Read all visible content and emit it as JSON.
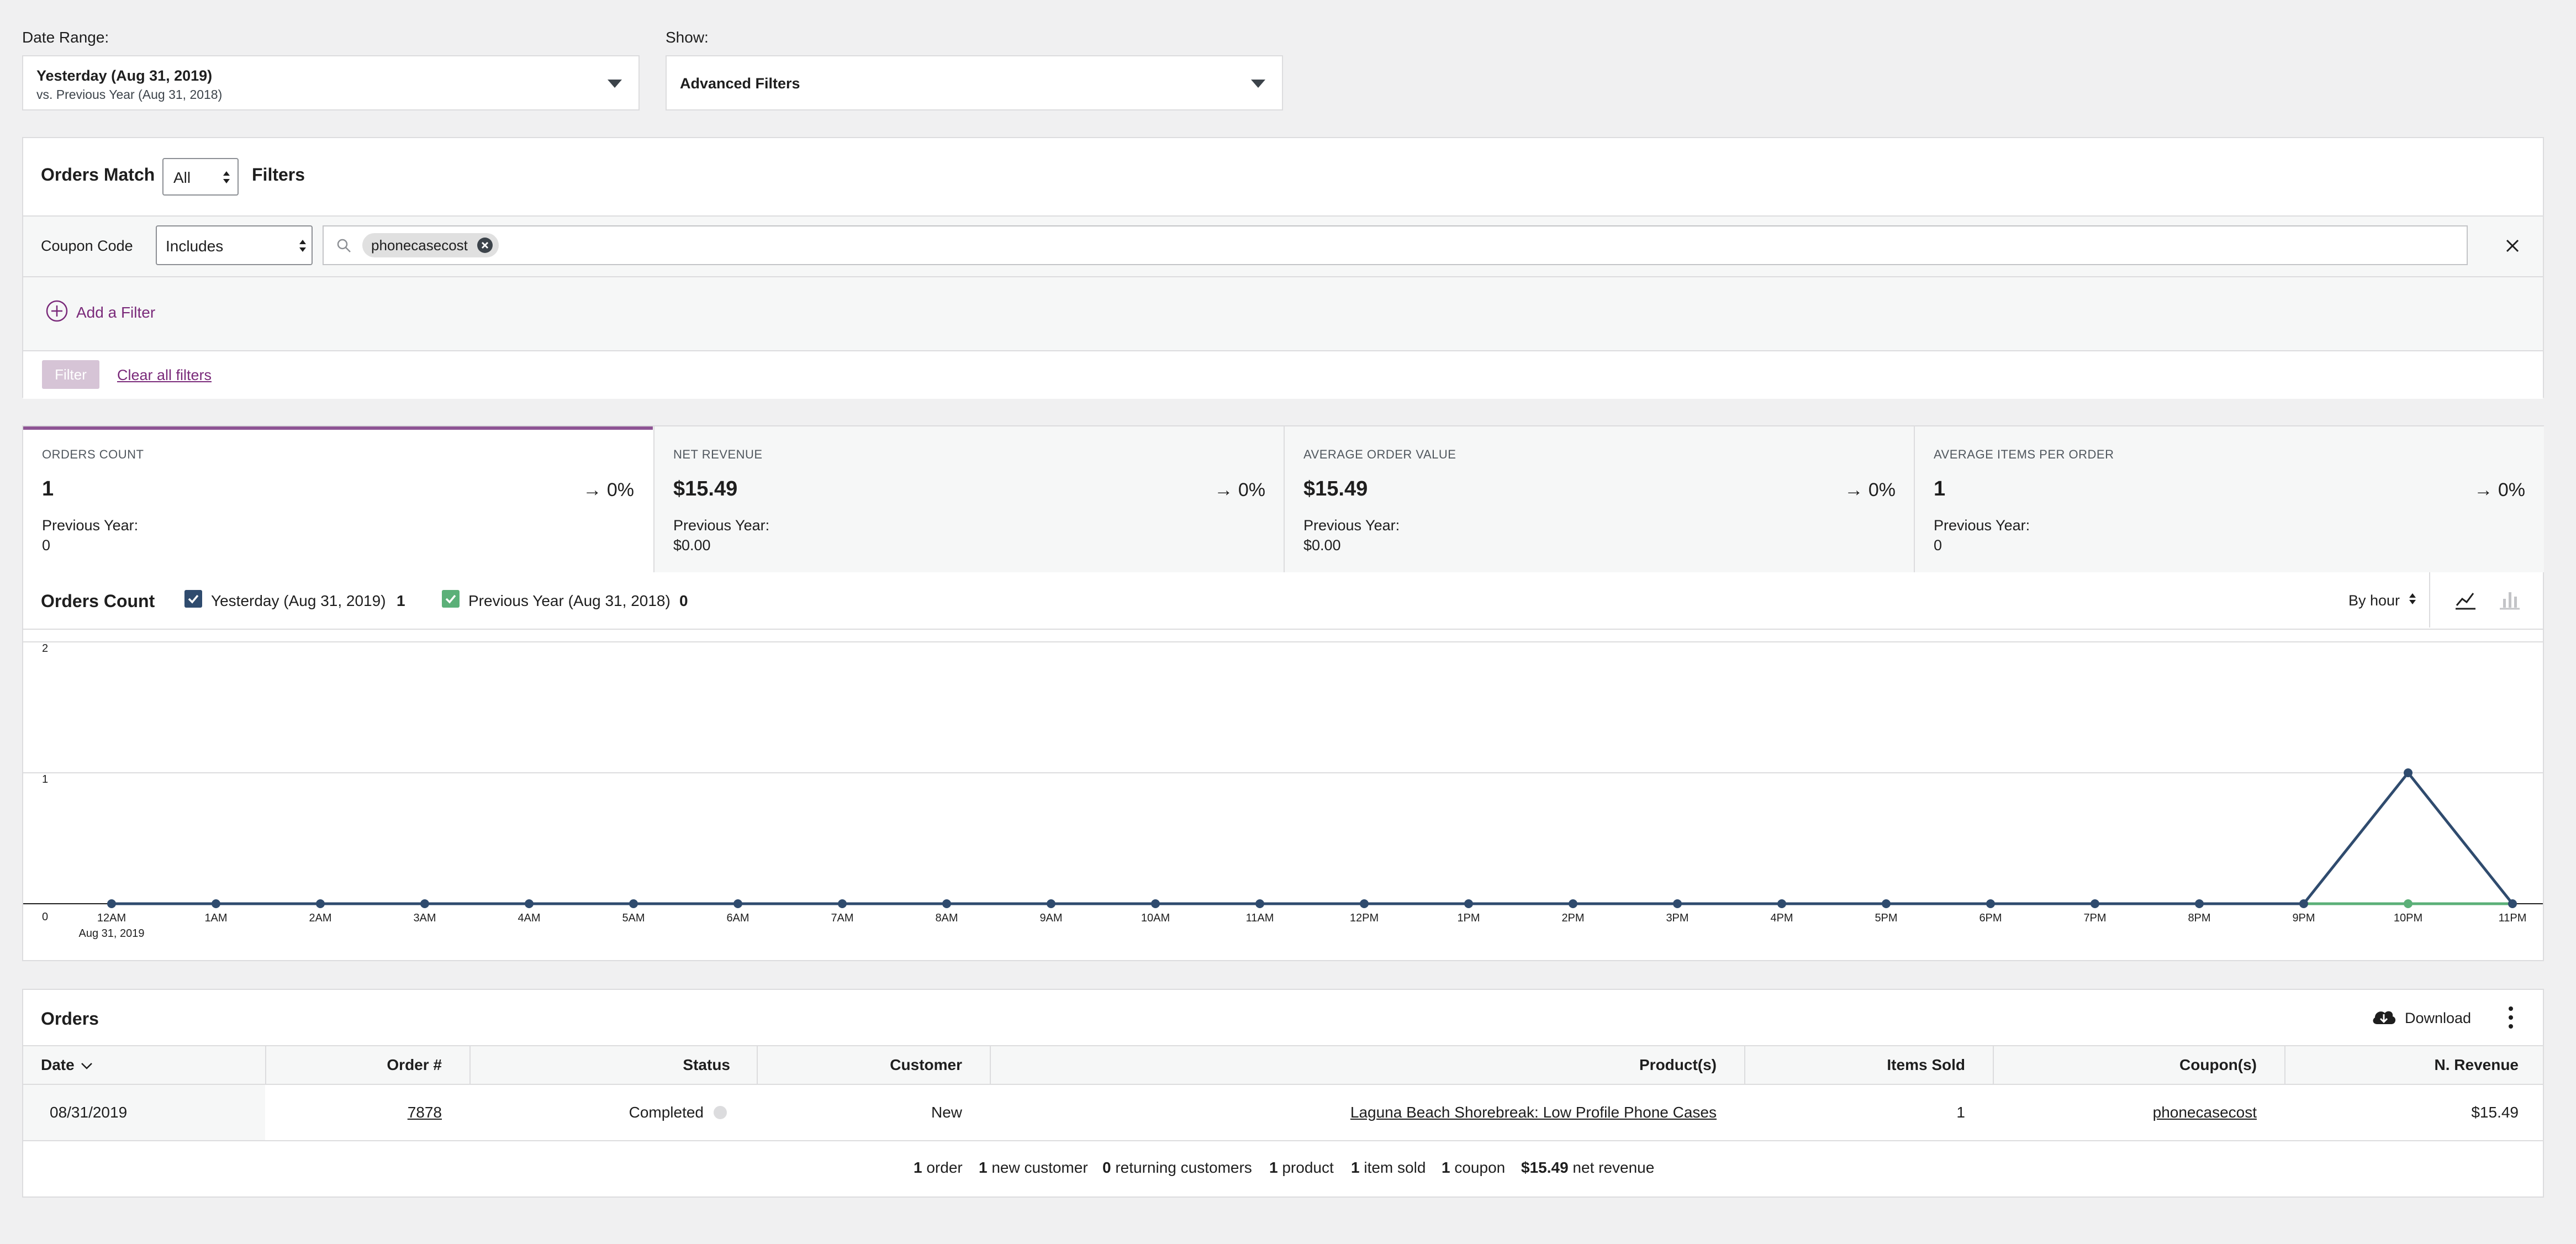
{
  "date_range": {
    "label": "Date Range:",
    "primary": "Yesterday (Aug 31, 2019)",
    "secondary": "vs. Previous Year (Aug 31, 2018)"
  },
  "show": {
    "label": "Show:",
    "value": "Advanced Filters"
  },
  "filters": {
    "orders_match": "Orders Match",
    "match_value": "All",
    "filters_label": "Filters",
    "coupon_label": "Coupon Code",
    "operator": "Includes",
    "tag": "phonecasecost",
    "add_filter": "Add a Filter",
    "filter_button": "Filter",
    "clear_all": "Clear all filters"
  },
  "metrics": [
    {
      "title": "ORDERS COUNT",
      "value": "1",
      "delta": "0%",
      "prev_label": "Previous Year:",
      "prev_value": "0"
    },
    {
      "title": "NET REVENUE",
      "value": "$15.49",
      "delta": "0%",
      "prev_label": "Previous Year:",
      "prev_value": "$0.00"
    },
    {
      "title": "AVERAGE ORDER VALUE",
      "value": "$15.49",
      "delta": "0%",
      "prev_label": "Previous Year:",
      "prev_value": "$0.00"
    },
    {
      "title": "AVERAGE ITEMS PER ORDER",
      "value": "1",
      "delta": "0%",
      "prev_label": "Previous Year:",
      "prev_value": "0"
    }
  ],
  "chart_header": {
    "title": "Orders Count",
    "legend1": "Yesterday (Aug 31, 2019)",
    "legend1_value": "1",
    "legend2": "Previous Year (Aug 31, 2018)",
    "legend2_value": "0",
    "interval": "By hour"
  },
  "chart_data": {
    "type": "line",
    "x": [
      "12AM",
      "1AM",
      "2AM",
      "3AM",
      "4AM",
      "5AM",
      "6AM",
      "7AM",
      "8AM",
      "9AM",
      "10AM",
      "11AM",
      "12PM",
      "1PM",
      "2PM",
      "3PM",
      "4PM",
      "5PM",
      "6PM",
      "7PM",
      "8PM",
      "9PM",
      "10PM",
      "11PM"
    ],
    "x_sublabel": "Aug 31, 2019",
    "y_ticks": [
      "0",
      "1",
      "2"
    ],
    "ylim": [
      0,
      2
    ],
    "series": [
      {
        "name": "Yesterday (Aug 31, 2019)",
        "color": "#2f4b6e",
        "values": [
          0,
          0,
          0,
          0,
          0,
          0,
          0,
          0,
          0,
          0,
          0,
          0,
          0,
          0,
          0,
          0,
          0,
          0,
          0,
          0,
          0,
          0,
          1,
          0
        ]
      },
      {
        "name": "Previous Year (Aug 31, 2018)",
        "color": "#5bb078",
        "values": [
          0,
          0,
          0,
          0,
          0,
          0,
          0,
          0,
          0,
          0,
          0,
          0,
          0,
          0,
          0,
          0,
          0,
          0,
          0,
          0,
          0,
          0,
          0,
          0
        ]
      }
    ]
  },
  "orders": {
    "title": "Orders",
    "download": "Download",
    "columns": [
      "Date",
      "Order #",
      "Status",
      "Customer",
      "Product(s)",
      "Items Sold",
      "Coupon(s)",
      "N. Revenue"
    ],
    "rows": [
      {
        "date": "08/31/2019",
        "order": "7878",
        "status": "Completed",
        "customer": "New",
        "product": "Laguna Beach Shorebreak: Low Profile Phone Cases",
        "items": "1",
        "coupon": "phonecasecost",
        "revenue": "$15.49"
      }
    ],
    "summary": [
      {
        "num": "1",
        "text": "order"
      },
      {
        "num": "1",
        "text": "new customer"
      },
      {
        "num": "0",
        "text": "returning customers"
      },
      {
        "num": "1",
        "text": "product"
      },
      {
        "num": "1",
        "text": "item sold"
      },
      {
        "num": "1",
        "text": "coupon"
      },
      {
        "num": "$15.49",
        "text": "net revenue"
      }
    ]
  }
}
